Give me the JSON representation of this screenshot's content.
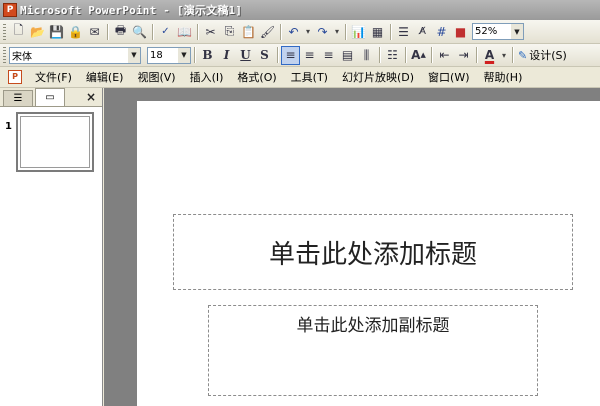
{
  "window": {
    "title": "Microsoft PowerPoint - [演示文稿1]",
    "app_icon": "P"
  },
  "toolbar_standard": {
    "zoom": "52%"
  },
  "toolbar_format": {
    "font": "宋体",
    "size": "18",
    "bold": "B",
    "italic": "I",
    "underline": "U",
    "shadow": "S",
    "font_color": "A",
    "design_label": "设计(S)"
  },
  "menu": {
    "items": [
      "文件(F)",
      "编辑(E)",
      "视图(V)",
      "插入(I)",
      "格式(O)",
      "工具(T)",
      "幻灯片放映(D)",
      "窗口(W)",
      "帮助(H)"
    ]
  },
  "slide_pane": {
    "slide_number": "1",
    "close": "×"
  },
  "slide": {
    "title_placeholder": "单击此处添加标题",
    "subtitle_placeholder": "单击此处添加副标题"
  }
}
